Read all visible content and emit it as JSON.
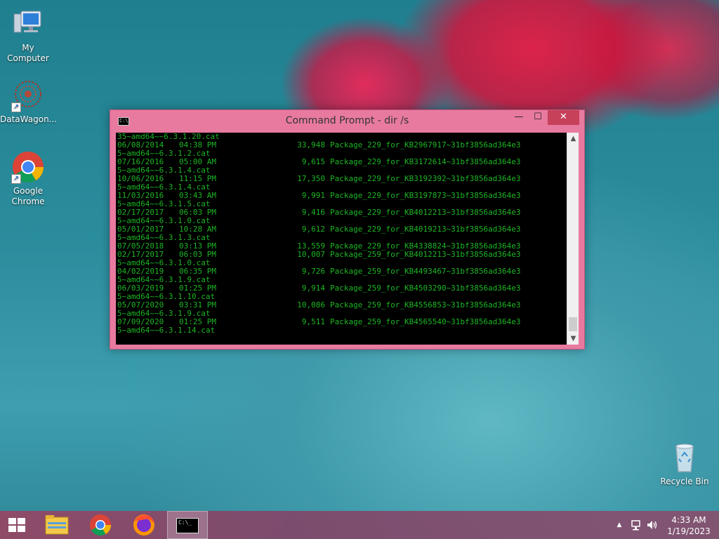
{
  "desktop": {
    "icons": [
      {
        "label": "My Computer"
      },
      {
        "label": "DataWagon..."
      },
      {
        "label": "Google Chrome"
      },
      {
        "label": "Recycle Bin"
      }
    ]
  },
  "window": {
    "title": "Command Prompt - dir  /s",
    "icon_text": "C:\\",
    "buttons": {
      "minimize": "—",
      "maximize": "☐",
      "close": "✕"
    },
    "lines": [
      {
        "text": "35~amd64~~6.3.1.20.cat"
      },
      {
        "date": "06/08/2014",
        "time": "04:38 PM",
        "size": "33,948",
        "name": "Package_229_for_KB2967917~31bf3856ad364e3"
      },
      {
        "text": "5~amd64~~6.3.1.2.cat"
      },
      {
        "date": "07/16/2016",
        "time": "05:00 AM",
        "size": "9,615",
        "name": "Package_229_for_KB3172614~31bf3856ad364e3"
      },
      {
        "text": "5~amd64~~6.3.1.4.cat"
      },
      {
        "date": "10/06/2016",
        "time": "11:15 PM",
        "size": "17,350",
        "name": "Package_229_for_KB3192392~31bf3856ad364e3"
      },
      {
        "text": "5~amd64~~6.3.1.4.cat"
      },
      {
        "date": "11/03/2016",
        "time": "03:43 AM",
        "size": "9,991",
        "name": "Package_229_for_KB3197873~31bf3856ad364e3"
      },
      {
        "text": "5~amd64~~6.3.1.5.cat"
      },
      {
        "date": "02/17/2017",
        "time": "06:03 PM",
        "size": "9,416",
        "name": "Package_229_for_KB4012213~31bf3856ad364e3"
      },
      {
        "text": "5~amd64~~6.3.1.0.cat"
      },
      {
        "date": "05/01/2017",
        "time": "10:28 AM",
        "size": "9,612",
        "name": "Package_229_for_KB4019213~31bf3856ad364e3"
      },
      {
        "text": "5~amd64~~6.3.1.3.cat"
      },
      {
        "date": "07/05/2018",
        "time": "03:13 PM",
        "size": "13,559",
        "name": "Package_229_for_KB4338824~31bf3856ad364e3"
      },
      {
        "date": "02/17/2017",
        "time": "06:03 PM",
        "size": "10,007",
        "name": "Package_259_for_KB4012213~31bf3856ad364e3"
      },
      {
        "text": "5~amd64~~6.3.1.0.cat"
      },
      {
        "date": "04/02/2019",
        "time": "06:35 PM",
        "size": "9,726",
        "name": "Package_259_for_KB4493467~31bf3856ad364e3"
      },
      {
        "text": "5~amd64~~6.3.1.9.cat"
      },
      {
        "date": "06/03/2019",
        "time": "01:25 PM",
        "size": "9,914",
        "name": "Package_259_for_KB4503290~31bf3856ad364e3"
      },
      {
        "text": "5~amd64~~6.3.1.10.cat"
      },
      {
        "date": "05/07/2020",
        "time": "03:31 PM",
        "size": "10,086",
        "name": "Package_259_for_KB4556853~31bf3856ad364e3"
      },
      {
        "text": "5~amd64~~6.3.1.9.cat"
      },
      {
        "date": "07/09/2020",
        "time": "01:25 PM",
        "size": "9,511",
        "name": "Package_259_for_KB4565540~31bf3856ad364e3"
      },
      {
        "text": "5~amd64~~6.3.1.14.cat"
      }
    ]
  },
  "taskbar": {
    "apps": [
      {
        "name": "file-explorer"
      },
      {
        "name": "google-chrome"
      },
      {
        "name": "firefox"
      },
      {
        "name": "command-prompt",
        "label": "C:\\_"
      }
    ],
    "tray_arrow": "▲",
    "clock": {
      "time": "4:33 AM",
      "date": "1/19/2023"
    }
  },
  "colors": {
    "console_text": "#1db524",
    "console_bg": "#000000",
    "window_frame": "#e87aa0",
    "close_button": "#c7415a"
  }
}
